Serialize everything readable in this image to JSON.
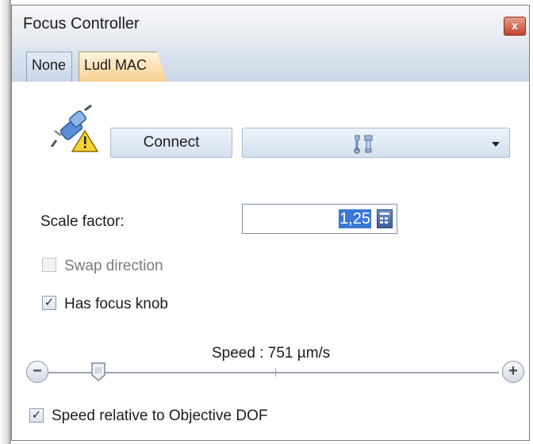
{
  "window": {
    "title": "Focus Controller",
    "close_glyph": "x"
  },
  "tabs": [
    {
      "label": "None",
      "selected": false
    },
    {
      "label": "Ludl MAC",
      "selected": true
    }
  ],
  "connection": {
    "status_icon": "plug-warning-icon",
    "connect_label": "Connect",
    "settings_icon": "wrench-settings-icon"
  },
  "scale": {
    "label": "Scale factor:",
    "value": "1,25",
    "calc_icon": "calculator-icon"
  },
  "options": {
    "swap_direction": {
      "label": "Swap direction",
      "checked": false,
      "enabled": false
    },
    "has_focus_knob": {
      "label": "Has focus knob",
      "checked": true,
      "enabled": true
    },
    "speed_relative": {
      "label": "Speed relative to Objective DOF",
      "checked": true,
      "enabled": true
    }
  },
  "speed": {
    "label": "Speed : 751 µm/s",
    "minus": "−",
    "plus": "+"
  },
  "colors": {
    "accent_tab": "#f6cf8e",
    "selection": "#3a78d8"
  }
}
